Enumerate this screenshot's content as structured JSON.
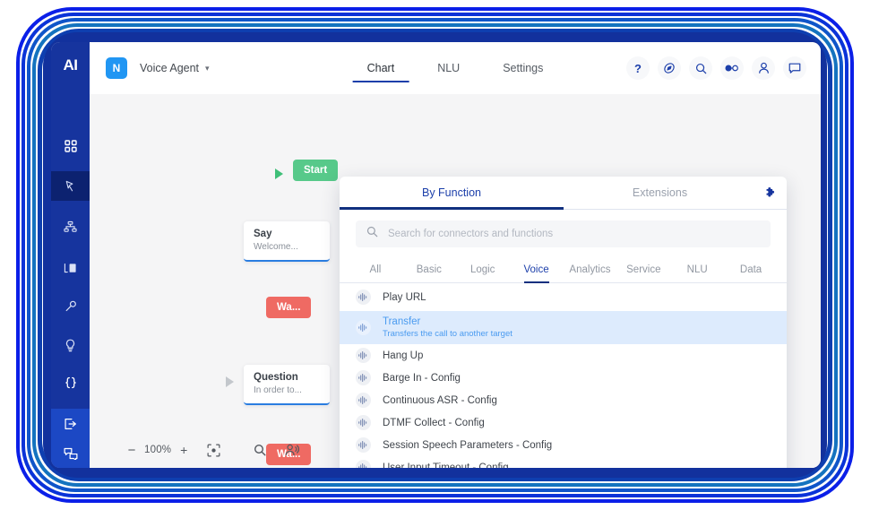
{
  "app": {
    "logo_text": "AI",
    "agent_initial": "N",
    "agent_name": "Voice Agent",
    "caret": "▾"
  },
  "sidebar": {
    "items": [
      {
        "name": "dashboard",
        "icon": "grid-icon",
        "active": false
      },
      {
        "name": "flow",
        "icon": "flow-cursor-icon",
        "active": true
      },
      {
        "name": "hierarchy",
        "icon": "sitemap-icon",
        "active": false
      },
      {
        "name": "logs",
        "icon": "list-icon",
        "active": false
      },
      {
        "name": "tools",
        "icon": "wrench-icon",
        "active": false
      },
      {
        "name": "insights",
        "icon": "lightbulb-icon",
        "active": false
      },
      {
        "name": "code",
        "icon": "braces-icon",
        "active": false
      },
      {
        "name": "deploy",
        "icon": "export-icon",
        "active": false
      },
      {
        "name": "chats",
        "icon": "chat-bubbles-icon",
        "active": false
      }
    ]
  },
  "topbar": {
    "tabs": [
      {
        "label": "Chart",
        "active": true
      },
      {
        "label": "NLU",
        "active": false
      },
      {
        "label": "Settings",
        "active": false
      }
    ],
    "icons": [
      {
        "name": "help-icon",
        "glyph": "?"
      },
      {
        "name": "compass-icon",
        "glyph": "compass"
      },
      {
        "name": "search-icon",
        "glyph": "search"
      },
      {
        "name": "connection-toggle-icon",
        "glyph": "dots"
      },
      {
        "name": "user-profile-icon",
        "glyph": "person"
      },
      {
        "name": "chat-icon",
        "glyph": "chat"
      }
    ]
  },
  "canvas": {
    "start_node": {
      "label": "Start"
    },
    "nodes": [
      {
        "title": "Say",
        "subtitle": "Welcome..."
      },
      {
        "title": "Question",
        "subtitle": "In order to..."
      }
    ],
    "red_nodes": [
      {
        "label": "Wa..."
      },
      {
        "label": "Wa..."
      }
    ]
  },
  "bottom_toolbar": {
    "zoom_out_label": "−",
    "zoom_level": "100%",
    "zoom_in_label": "+",
    "fit_icon": "fit-to-screen-icon",
    "search_icon": "search-icon",
    "voice_icon": "voice-user-icon"
  },
  "function_panel": {
    "tabs": [
      {
        "label": "By Function",
        "active": true
      },
      {
        "label": "Extensions",
        "active": false
      }
    ],
    "extensions_icon": "puzzle-piece-icon",
    "search": {
      "placeholder": "Search for connectors and functions",
      "value": ""
    },
    "categories": [
      {
        "label": "All",
        "active": false
      },
      {
        "label": "Basic",
        "active": false
      },
      {
        "label": "Logic",
        "active": false
      },
      {
        "label": "Voice",
        "active": true
      },
      {
        "label": "Analytics",
        "active": false
      },
      {
        "label": "Service",
        "active": false
      },
      {
        "label": "NLU",
        "active": false
      },
      {
        "label": "Data",
        "active": false
      }
    ],
    "items": [
      {
        "label": "Play URL",
        "desc": "",
        "selected": false
      },
      {
        "label": "Transfer",
        "desc": "Transfers the call to another target",
        "selected": true
      },
      {
        "label": "Hang Up",
        "desc": "",
        "selected": false
      },
      {
        "label": "Barge In - Config",
        "desc": "",
        "selected": false
      },
      {
        "label": "Continuous ASR - Config",
        "desc": "",
        "selected": false
      },
      {
        "label": "DTMF Collect - Config",
        "desc": "",
        "selected": false
      },
      {
        "label": "Session Speech Parameters - Config",
        "desc": "",
        "selected": false
      },
      {
        "label": "User Input Timeout - Config",
        "desc": "",
        "selected": false
      }
    ]
  },
  "colors": {
    "brand_blue": "#16349e",
    "accent_blue": "#1c3faa",
    "selected_row": "#ddebfd",
    "start_green": "#57c98a",
    "wait_red": "#ef6a63",
    "canvas_bg": "#f5f5f6"
  }
}
